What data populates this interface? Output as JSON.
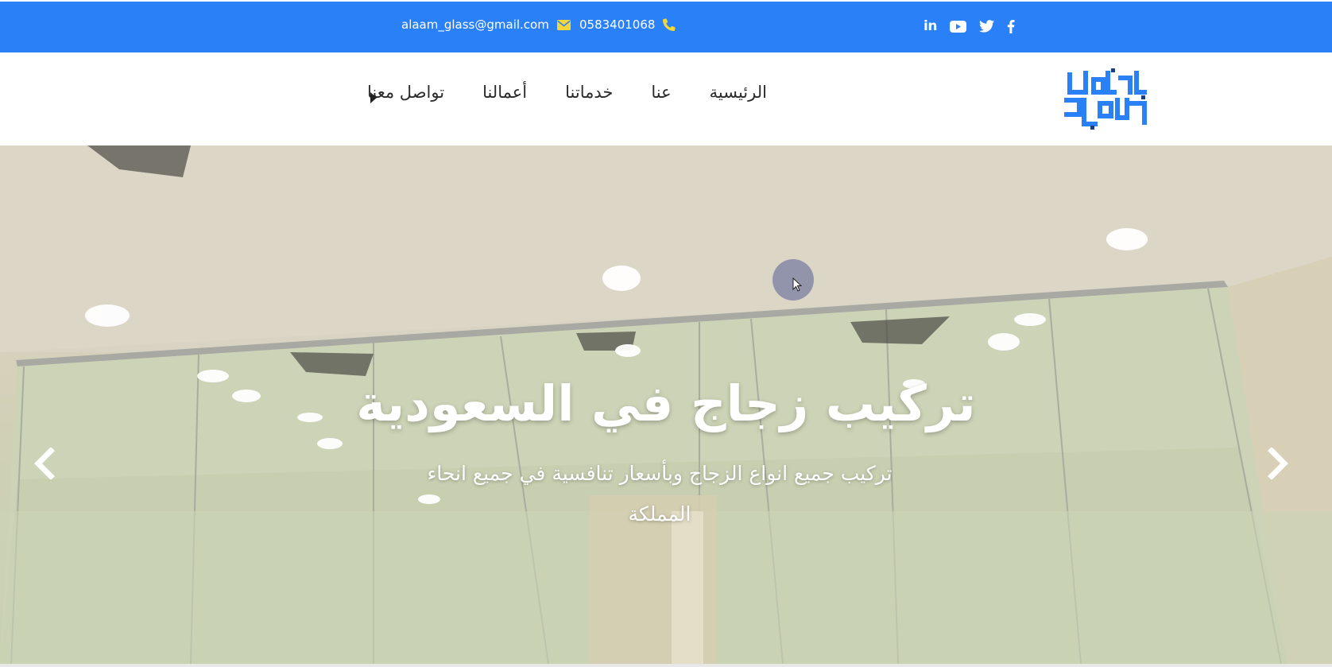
{
  "topbar": {
    "email": "alaam_glass@gmail.com",
    "phone": "0583401068",
    "email_icon": "envelope-icon",
    "phone_icon": "phone-icon",
    "social": [
      "linkedin-icon",
      "youtube-icon",
      "twitter-icon",
      "facebook-icon"
    ],
    "bg_color": "#2a80f7",
    "icon_color": "#f3d63b"
  },
  "nav": {
    "items": [
      {
        "label": "الرئيسية"
      },
      {
        "label": "عنا"
      },
      {
        "label": "خدماتنا"
      },
      {
        "label": "أعمالنا"
      },
      {
        "label": "تواصل معنا"
      }
    ],
    "more_icon": "caret-right-icon",
    "logo_text": "عالم الزجاج"
  },
  "hero": {
    "title": "تركيب زجاج في السعودية",
    "subtitle": "تركيب جميع انواع الزجاج وبأسعار تنافسية في جميع انحاء المملكة",
    "prev_icon": "chevron-left-icon",
    "next_icon": "chevron-right-icon"
  }
}
